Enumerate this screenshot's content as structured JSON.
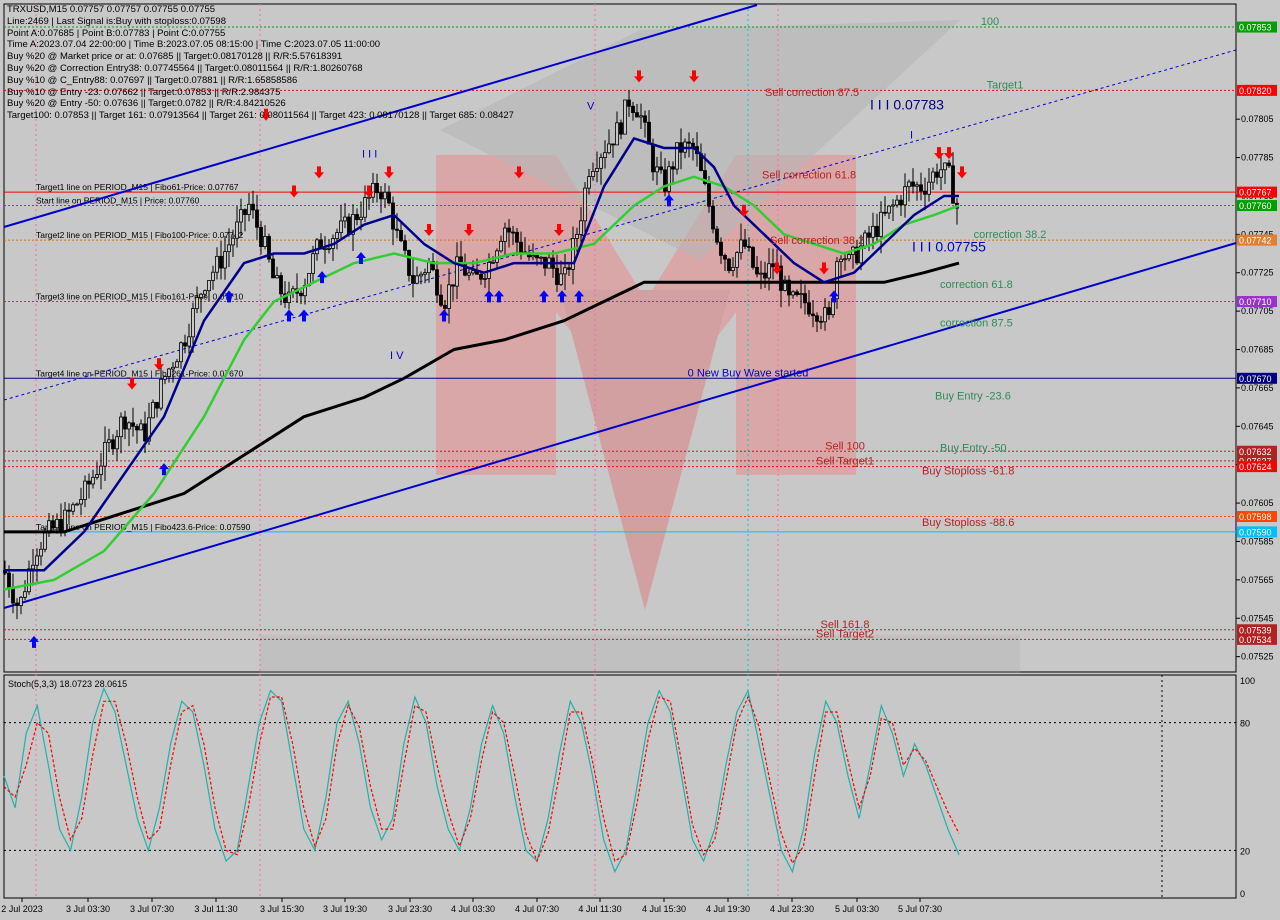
{
  "header": {
    "symbol_line": "TRXUSD,M15  0.07757 0.07757 0.07755 0.07755",
    "info_lines": [
      "Line:2469 | Last Signal is:Buy with stoploss:0.07598",
      "Point A:0.07685 | Point B:0.07783 | Point C:0.07755",
      "Time A:2023.07.04 22:00:00 | Time B:2023.07.05 08:15:00 | Time C:2023.07.05 11:00:00",
      "Buy %20 @ Market price or at: 0.07685 || Target:0.08170128 || R/R:5.57618391",
      "Buy %20 @ Correction Entry38: 0.07745564 || Target:0.08011564 || R/R:1.80260768",
      "Buy %10 @ C_Entry88: 0.07697 || Target:0.07881 || R/R:1.65858586",
      "Buy %10 @ Entry -23: 0.07662 || Target:0.07853 || R/R:2.984375",
      "Buy %20 @ Entry -50: 0.07636 || Target:0.0782 || R/R:4.84210526",
      "Target100: 0.07853 || Target 161: 0.07913564 || Target 261: 0.08011564 || Target 423: 0.08170128 || Target 685: 0.08427"
    ]
  },
  "chart_data": [
    {
      "type": "candlestick",
      "symbol": "TRXUSD",
      "timeframe": "M15",
      "ylim": [
        0.07517,
        0.07865
      ],
      "price_ticks": [
        "0.07805",
        "0.07785",
        "0.07765",
        "0.07745",
        "0.07725",
        "0.07705",
        "0.07685",
        "0.07665",
        "0.07645",
        "0.07625",
        "0.07605",
        "0.07585",
        "0.07565",
        "0.07545",
        "0.07525"
      ],
      "time_labels": [
        "2 Jul 2023",
        "3 Jul 03:30",
        "3 Jul 07:30",
        "3 Jul 11:30",
        "3 Jul 15:30",
        "3 Jul 19:30",
        "3 Jul 23:30",
        "4 Jul 03:30",
        "4 Jul 07:30",
        "4 Jul 11:30",
        "4 Jul 15:30",
        "4 Jul 19:30",
        "4 Jul 23:30",
        "5 Jul 03:30",
        "5 Jul 07:30"
      ],
      "close_path": [
        [
          0,
          0.0757
        ],
        [
          15,
          0.0755
        ],
        [
          30,
          0.0758
        ],
        [
          45,
          0.0759
        ],
        [
          60,
          0.07596
        ],
        [
          80,
          0.0761
        ],
        [
          100,
          0.0763
        ],
        [
          120,
          0.0765
        ],
        [
          140,
          0.0764
        ],
        [
          160,
          0.0767
        ],
        [
          180,
          0.0769
        ],
        [
          200,
          0.0772
        ],
        [
          215,
          0.0773
        ],
        [
          230,
          0.07745
        ],
        [
          245,
          0.0776
        ],
        [
          260,
          0.0774
        ],
        [
          270,
          0.0772
        ],
        [
          285,
          0.0771
        ],
        [
          300,
          0.0772
        ],
        [
          315,
          0.0774
        ],
        [
          330,
          0.07745
        ],
        [
          345,
          0.0775
        ],
        [
          360,
          0.0776
        ],
        [
          375,
          0.0777
        ],
        [
          385,
          0.0776
        ],
        [
          395,
          0.0774
        ],
        [
          410,
          0.0772
        ],
        [
          425,
          0.0773
        ],
        [
          440,
          0.0771
        ],
        [
          455,
          0.0773
        ],
        [
          470,
          0.0772
        ],
        [
          485,
          0.0773
        ],
        [
          500,
          0.0775
        ],
        [
          515,
          0.0774
        ],
        [
          530,
          0.0773
        ],
        [
          545,
          0.0773
        ],
        [
          560,
          0.0772
        ],
        [
          575,
          0.0775
        ],
        [
          585,
          0.0778
        ],
        [
          600,
          0.0779
        ],
        [
          615,
          0.078
        ],
        [
          625,
          0.07815
        ],
        [
          635,
          0.0781
        ],
        [
          650,
          0.0778
        ],
        [
          660,
          0.0777
        ],
        [
          675,
          0.0779
        ],
        [
          690,
          0.0779
        ],
        [
          700,
          0.0777
        ],
        [
          715,
          0.0774
        ],
        [
          725,
          0.0773
        ],
        [
          740,
          0.0774
        ],
        [
          755,
          0.0772
        ],
        [
          770,
          0.0773
        ],
        [
          785,
          0.0771
        ],
        [
          800,
          0.0771
        ],
        [
          815,
          0.07705
        ],
        [
          825,
          0.077
        ],
        [
          835,
          0.0774
        ],
        [
          845,
          0.0773
        ],
        [
          860,
          0.0774
        ],
        [
          875,
          0.0775
        ],
        [
          890,
          0.0776
        ],
        [
          905,
          0.0777
        ],
        [
          920,
          0.0777
        ],
        [
          935,
          0.0778
        ],
        [
          945,
          0.07775
        ],
        [
          955,
          0.07755
        ]
      ],
      "ma_fast": [
        [
          0,
          0.0757
        ],
        [
          40,
          0.0757
        ],
        [
          80,
          0.0759
        ],
        [
          120,
          0.0762
        ],
        [
          160,
          0.0765
        ],
        [
          200,
          0.077
        ],
        [
          240,
          0.0773
        ],
        [
          270,
          0.07735
        ],
        [
          300,
          0.07735
        ],
        [
          330,
          0.0774
        ],
        [
          360,
          0.0775
        ],
        [
          390,
          0.07755
        ],
        [
          420,
          0.0774
        ],
        [
          450,
          0.0773
        ],
        [
          480,
          0.07725
        ],
        [
          510,
          0.0773
        ],
        [
          540,
          0.0773
        ],
        [
          570,
          0.0773
        ],
        [
          600,
          0.0777
        ],
        [
          630,
          0.07795
        ],
        [
          660,
          0.0779
        ],
        [
          690,
          0.0779
        ],
        [
          710,
          0.0778
        ],
        [
          730,
          0.0776
        ],
        [
          760,
          0.07745
        ],
        [
          790,
          0.0773
        ],
        [
          820,
          0.0772
        ],
        [
          850,
          0.07725
        ],
        [
          880,
          0.0774
        ],
        [
          910,
          0.07755
        ],
        [
          940,
          0.07765
        ],
        [
          955,
          0.07765
        ]
      ],
      "ma_mid": [
        [
          0,
          0.0756
        ],
        [
          50,
          0.07565
        ],
        [
          100,
          0.0758
        ],
        [
          150,
          0.0761
        ],
        [
          200,
          0.0765
        ],
        [
          240,
          0.0769
        ],
        [
          270,
          0.0771
        ],
        [
          310,
          0.0772
        ],
        [
          350,
          0.0773
        ],
        [
          390,
          0.07735
        ],
        [
          430,
          0.0773
        ],
        [
          470,
          0.0773
        ],
        [
          510,
          0.07735
        ],
        [
          550,
          0.07735
        ],
        [
          590,
          0.0774
        ],
        [
          630,
          0.0776
        ],
        [
          660,
          0.0777
        ],
        [
          690,
          0.07775
        ],
        [
          720,
          0.0777
        ],
        [
          750,
          0.0776
        ],
        [
          780,
          0.07745
        ],
        [
          810,
          0.0774
        ],
        [
          840,
          0.07735
        ],
        [
          870,
          0.0774
        ],
        [
          900,
          0.0775
        ],
        [
          930,
          0.07755
        ],
        [
          955,
          0.0776
        ]
      ],
      "ma_slow": [
        [
          0,
          0.0759
        ],
        [
          60,
          0.0759
        ],
        [
          120,
          0.076
        ],
        [
          180,
          0.0761
        ],
        [
          240,
          0.0763
        ],
        [
          300,
          0.0765
        ],
        [
          360,
          0.0766
        ],
        [
          400,
          0.0767
        ],
        [
          450,
          0.07685
        ],
        [
          500,
          0.0769
        ],
        [
          560,
          0.077
        ],
        [
          600,
          0.0771
        ],
        [
          640,
          0.0772
        ],
        [
          680,
          0.0772
        ],
        [
          720,
          0.0772
        ],
        [
          760,
          0.0772
        ],
        [
          800,
          0.0772
        ],
        [
          840,
          0.0772
        ],
        [
          880,
          0.0772
        ],
        [
          920,
          0.07725
        ],
        [
          955,
          0.0773
        ]
      ],
      "stochastic": {
        "label": "Stoch(5,3,3) 18.0723 28.0615",
        "ylim": [
          0,
          100
        ],
        "levels": [
          "100",
          "80",
          "20",
          "0"
        ],
        "main_values": [
          55,
          40,
          75,
          88,
          60,
          30,
          20,
          45,
          80,
          96,
          85,
          60,
          35,
          20,
          40,
          70,
          90,
          85,
          60,
          30,
          15,
          20,
          50,
          80,
          95,
          90,
          60,
          30,
          20,
          45,
          80,
          90,
          70,
          40,
          25,
          35,
          70,
          92,
          80,
          50,
          30,
          20,
          40,
          70,
          88,
          75,
          45,
          20,
          15,
          35,
          65,
          90,
          80,
          55,
          25,
          10,
          20,
          50,
          80,
          95,
          85,
          55,
          25,
          15,
          30,
          60,
          85,
          95,
          70,
          45,
          20,
          10,
          30,
          65,
          90,
          80,
          55,
          35,
          60,
          88,
          75,
          55,
          70,
          60,
          45,
          30,
          18
        ],
        "signal_values": [
          50,
          45,
          60,
          80,
          75,
          45,
          25,
          35,
          65,
          90,
          90,
          70,
          45,
          25,
          30,
          60,
          85,
          88,
          70,
          40,
          20,
          18,
          40,
          70,
          92,
          92,
          70,
          40,
          22,
          35,
          70,
          88,
          78,
          50,
          30,
          30,
          60,
          88,
          85,
          60,
          38,
          22,
          35,
          62,
          85,
          80,
          55,
          28,
          15,
          28,
          55,
          85,
          85,
          62,
          35,
          15,
          18,
          42,
          72,
          92,
          90,
          62,
          32,
          18,
          25,
          52,
          80,
          92,
          78,
          52,
          28,
          14,
          22,
          55,
          85,
          85,
          62,
          40,
          55,
          82,
          80,
          60,
          68,
          62,
          50,
          38,
          28
        ]
      }
    }
  ],
  "levels": [
    {
      "price": "0.07853",
      "color": "#00a000",
      "left_label": "",
      "mid_label": "100",
      "mid_color": "#2e8b57",
      "style": "dot"
    },
    {
      "price": "0.07820",
      "color": "#ff0000",
      "left_label": "",
      "mid_label": "Target1",
      "mid_color": "#2e8b57",
      "style": "dot"
    },
    {
      "price": "0.07767",
      "color": "#ff0000",
      "left_label": "Target1 line on PERIOD_M15 | Fibo61-Price: 0.07767",
      "mid_label": "",
      "mid_color": "#000",
      "style": "solid"
    },
    {
      "price": "0.07760",
      "color": "#00a000",
      "left_label": "Start line on PERIOD_M15 | Price: 0.07760",
      "mid_label": "",
      "mid_color": "#000",
      "style": "dot"
    },
    {
      "price": "0.07742",
      "color": "#e07000",
      "left_label": "Target2 line on PERIOD_M15 | Fibo100-Price: 0.07742",
      "mid_label": "correction 38.2",
      "mid_color": "#2e8b57",
      "style": "dot"
    },
    {
      "price": "0.07710",
      "color": "#8a2be2",
      "left_label": "Target3 line on PERIOD_M15 | Fibo161-Price: 0.07710",
      "mid_label": "",
      "mid_color": "#000",
      "style": "dot"
    },
    {
      "price": "0.07670",
      "color": "#000080",
      "left_label": "Target4 line on PERIOD_M15 | Fibo261-Price: 0.07670",
      "mid_label": "0 New Buy Wave started",
      "mid_color": "#0000cd",
      "style": "solid"
    },
    {
      "price": "0.07632",
      "color": "#b22222",
      "left_label": "",
      "mid_label": "Sell 100",
      "mid_color": "#b22222",
      "style": "dot"
    },
    {
      "price": "0.07627",
      "color": "#b22222",
      "left_label": "",
      "mid_label": "",
      "mid_color": "#b22222",
      "style": "dot"
    },
    {
      "price": "0.07624",
      "color": "#ff0000",
      "left_label": "",
      "mid_label": "Sell Target1",
      "mid_color": "#b22222",
      "style": "dot"
    },
    {
      "price": "0.07598",
      "color": "#ff4500",
      "left_label": "",
      "mid_label": "",
      "mid_color": "#000",
      "style": "dot"
    },
    {
      "price": "0.07590",
      "color": "#00bfff",
      "left_label": "Target5 line on PERIOD_M15 | Fibo423.6-Price: 0.07590",
      "mid_label": "",
      "mid_color": "#000",
      "style": "solid"
    },
    {
      "price": "0.07539",
      "color": "#b22222",
      "left_label": "",
      "mid_label": "Sell 161.8",
      "mid_color": "#b22222",
      "style": "dot"
    },
    {
      "price": "0.07534",
      "color": "#b22222",
      "left_label": "",
      "mid_label": "Sell Target2",
      "mid_color": "#b22222",
      "style": "dot"
    }
  ],
  "annotations": [
    {
      "text": "Sell correction 87.5",
      "color": "#b22222",
      "price": 0.07817,
      "xpos": 765
    },
    {
      "text": "Sell correction 61.8",
      "color": "#b22222",
      "price": 0.07774,
      "xpos": 762
    },
    {
      "text": "Sell correction 38.2",
      "color": "#b22222",
      "price": 0.0774,
      "xpos": 770
    },
    {
      "text": "I I I 0.07783",
      "color": "#000080",
      "price": 0.0781,
      "xpos": 870
    },
    {
      "text": "I I I 0.07755",
      "color": "#0000cd",
      "price": 0.07736,
      "xpos": 912
    },
    {
      "text": "correction 61.8",
      "color": "#2e8b57",
      "price": 0.07717,
      "xpos": 940
    },
    {
      "text": "correction 87.5",
      "color": "#2e8b57",
      "price": 0.07697,
      "xpos": 940
    },
    {
      "text": "Buy Entry -23.6",
      "color": "#2e8b57",
      "price": 0.07659,
      "xpos": 935
    },
    {
      "text": "Buy Entry -50",
      "color": "#2e8b57",
      "price": 0.07632,
      "xpos": 940
    },
    {
      "text": "Buy Stoploss -61.8",
      "color": "#b22222",
      "price": 0.0762,
      "xpos": 922
    },
    {
      "text": "Buy Stoploss -88.6",
      "color": "#b22222",
      "price": 0.07593,
      "xpos": 922
    },
    {
      "text": "I I I",
      "color": "#0000cd",
      "price": 0.07785,
      "xpos": 362
    },
    {
      "text": "I V",
      "color": "#0000cd",
      "price": 0.0768,
      "xpos": 390
    },
    {
      "text": "V",
      "color": "#0000cd",
      "price": 0.0781,
      "xpos": 587
    },
    {
      "text": "I",
      "color": "#0000cd",
      "price": 0.07795,
      "xpos": 910
    }
  ],
  "right_axis_tags": [
    {
      "price": "0.07853",
      "bg": "#00a000"
    },
    {
      "price": "0.07820",
      "bg": "#ff0000"
    },
    {
      "price": "0.07767",
      "bg": "#ff0000"
    },
    {
      "price": "0.07760",
      "bg": "#00a000"
    },
    {
      "price": "0.07742",
      "bg": "#e08030"
    },
    {
      "price": "0.07710",
      "bg": "#9932cc"
    },
    {
      "price": "0.07670",
      "bg": "#000080"
    },
    {
      "price": "0.07632",
      "bg": "#b22222"
    },
    {
      "price": "0.07627",
      "bg": "#b22222"
    },
    {
      "price": "0.07624",
      "bg": "#ff0000"
    },
    {
      "price": "0.07598",
      "bg": "#ff4500"
    },
    {
      "price": "0.07590",
      "bg": "#00bfff"
    },
    {
      "price": "0.07539",
      "bg": "#b22222"
    },
    {
      "price": "0.07534",
      "bg": "#b22222"
    }
  ],
  "buy_arrows": [
    [
      30,
      0.0754
    ],
    [
      160,
      0.0763
    ],
    [
      225,
      0.0772
    ],
    [
      285,
      0.0771
    ],
    [
      300,
      0.0771
    ],
    [
      318,
      0.0773
    ],
    [
      357,
      0.0774
    ],
    [
      440,
      0.0771
    ],
    [
      485,
      0.0772
    ],
    [
      495,
      0.0772
    ],
    [
      540,
      0.0772
    ],
    [
      558,
      0.0772
    ],
    [
      575,
      0.0772
    ],
    [
      665,
      0.0777
    ],
    [
      830,
      0.0772
    ]
  ],
  "sell_arrows": [
    [
      128,
      0.0766
    ],
    [
      155,
      0.0767
    ],
    [
      262,
      0.078
    ],
    [
      290,
      0.0776
    ],
    [
      315,
      0.0777
    ],
    [
      365,
      0.0776
    ],
    [
      385,
      0.0777
    ],
    [
      425,
      0.0774
    ],
    [
      465,
      0.0774
    ],
    [
      515,
      0.0777
    ],
    [
      555,
      0.0774
    ],
    [
      635,
      0.0782
    ],
    [
      690,
      0.0782
    ],
    [
      740,
      0.0775
    ],
    [
      773,
      0.0772
    ],
    [
      820,
      0.0772
    ],
    [
      935,
      0.0778
    ],
    [
      945,
      0.0778
    ],
    [
      958,
      0.0777
    ]
  ],
  "colors": {
    "background": "#c8c8c8",
    "channel": "#0000cd",
    "ma_fast": "#00008b",
    "ma_mid": "#32cd32",
    "ma_slow": "#000000",
    "stoch_main": "#20b2aa",
    "stoch_signal": "#ff0000",
    "watermark": "#f08080"
  }
}
